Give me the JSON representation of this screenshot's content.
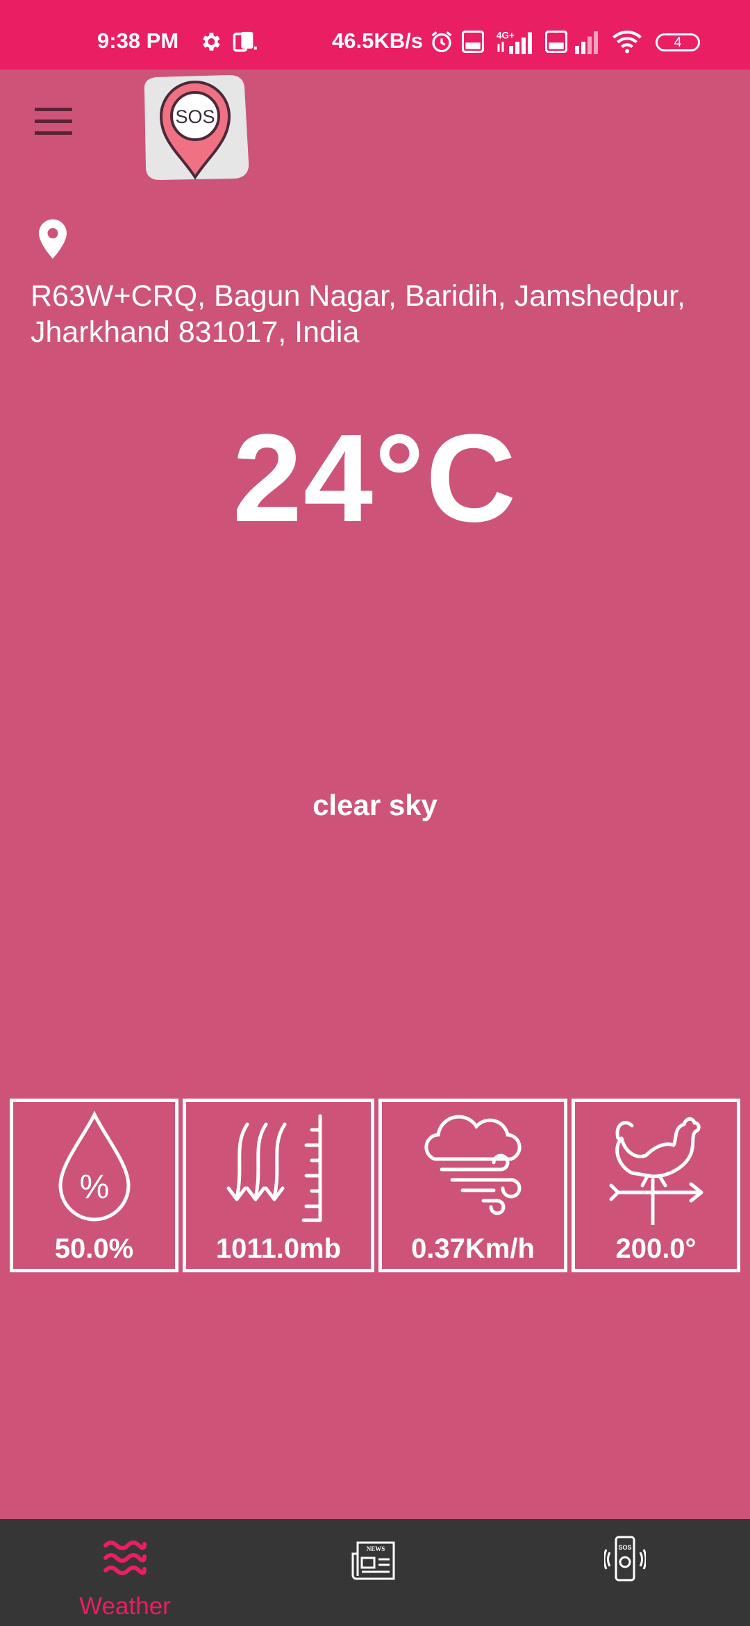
{
  "status_bar": {
    "time": "9:38 PM",
    "network_speed": "46.5KB/s",
    "network_type": "4G+",
    "battery": "4"
  },
  "header": {
    "logo_text": "SOS"
  },
  "location": {
    "address": "R63W+CRQ, Bagun Nagar, Baridih, Jamshedpur, Jharkhand 831017, India"
  },
  "weather": {
    "temperature": "24°C",
    "condition": "clear sky"
  },
  "stats": {
    "humidity": "50.0%",
    "pressure": "1011.0mb",
    "wind_speed": "0.37Km/h",
    "wind_direction": "200.0°"
  },
  "nav": {
    "weather_label": "Weather",
    "news_icon_text": "NEWS",
    "sos_icon_text": "SOS"
  },
  "colors": {
    "background": "#cd5478",
    "status_bar": "#e91e63",
    "accent": "#e91e63",
    "nav_background": "#363636"
  }
}
